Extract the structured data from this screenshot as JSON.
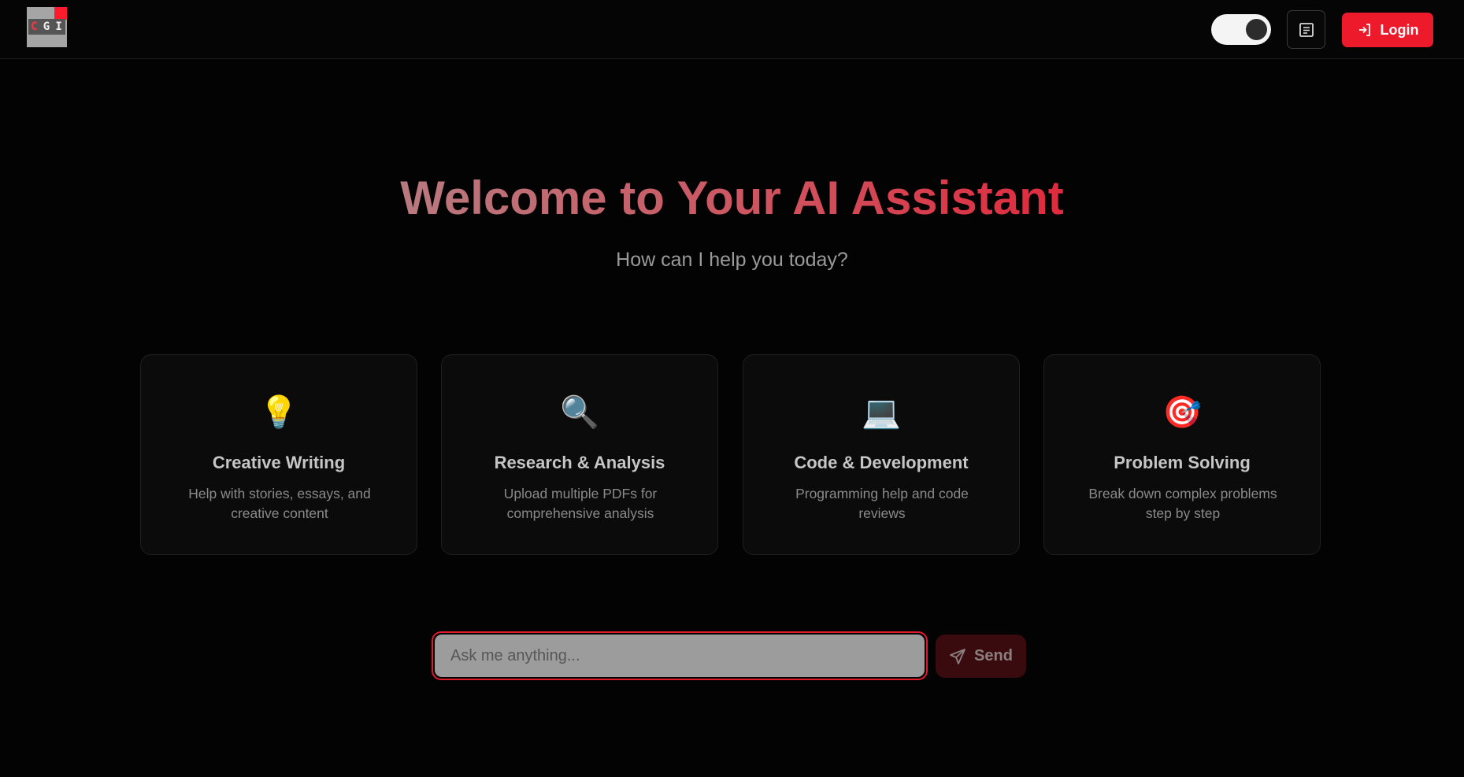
{
  "header": {
    "logo": {
      "letters": [
        "C",
        "G",
        "I"
      ]
    },
    "theme_toggle": {
      "state": "dark",
      "icon": "toggle-knob"
    },
    "doc_button": {
      "icon": "document-icon"
    },
    "login": {
      "label": "Login",
      "icon": "login-icon"
    }
  },
  "hero": {
    "title": "Welcome to Your AI Assistant",
    "subtitle": "How can I help you today?"
  },
  "cards": [
    {
      "emoji": "💡",
      "icon": "lightbulb-icon",
      "title": "Creative Writing",
      "desc": "Help with stories, essays, and creative content"
    },
    {
      "emoji": "🔍",
      "icon": "magnifier-icon",
      "title": "Research & Analysis",
      "desc": "Upload multiple PDFs for comprehensive analysis"
    },
    {
      "emoji": "💻",
      "icon": "laptop-icon",
      "title": "Code & Development",
      "desc": "Programming help and code reviews"
    },
    {
      "emoji": "🎯",
      "icon": "target-icon",
      "title": "Problem Solving",
      "desc": "Break down complex problems step by step"
    }
  ],
  "chat": {
    "placeholder": "Ask me anything...",
    "value": "",
    "send_label": "Send",
    "send_icon": "send-icon"
  },
  "colors": {
    "accent": "#ec1a2a",
    "background": "#030303",
    "card_bg": "#0b0b0b"
  }
}
